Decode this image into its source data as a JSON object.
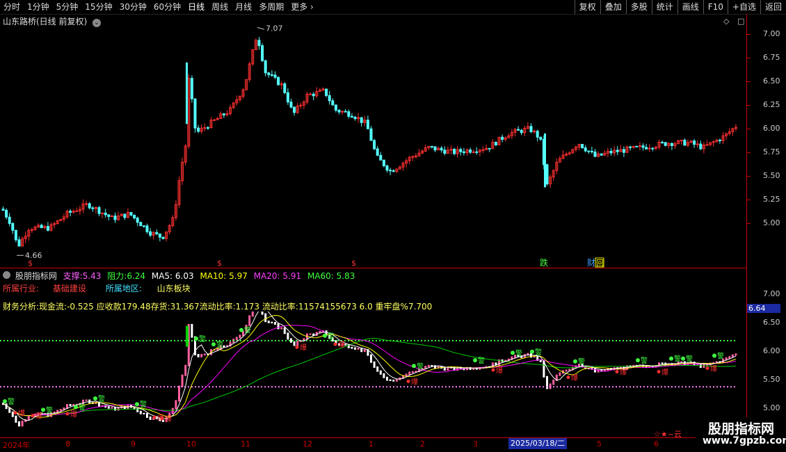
{
  "toolbar": {
    "periods": [
      "分时",
      "1分钟",
      "5分钟",
      "15分钟",
      "30分钟",
      "60分钟",
      "日线",
      "周线",
      "月线",
      "多周期",
      "更多"
    ],
    "active_period": "日线",
    "right_buttons": [
      "复权",
      "叠加",
      "多股",
      "统计",
      "画线",
      "F10",
      "+自选",
      "返回"
    ]
  },
  "main_chart": {
    "title": "山东路桥(日线 前复权)",
    "high_label": "7.07",
    "low_label": "4.66",
    "y_ticks": [
      "7.00",
      "6.75",
      "6.50",
      "6.25",
      "6.00",
      "5.75",
      "5.50",
      "5.25",
      "5.00"
    ],
    "markers": [
      "跌",
      "财",
      "回"
    ],
    "dividend_marker": "$"
  },
  "indicator": {
    "name": "股朋指标网",
    "support_label": "支撑:",
    "support": "5.43",
    "resist_label": "阻力:",
    "resist": "6.24",
    "ma5": "MA5: 6.03",
    "ma10": "MA10: 5.97",
    "ma20": "MA20: 5.91",
    "ma60": "MA60: 5.83",
    "industry_label": "所属行业:",
    "industry": "基础建设",
    "region_label": "所属地区:",
    "region": "山东板块",
    "finance": "财务分析:现金流:-0.525 应收款179.48存货:31.367流动比率:1.173 流动比率:11574155673 6.0 重牢盘%7.700",
    "y_ticks": [
      "7.00",
      "6.50",
      "6.00",
      "5.50",
      "5.00"
    ],
    "current_price": "6.64",
    "warn_label": "警",
    "burst_label": "爆"
  },
  "x_axis": {
    "labels": [
      "2024年",
      "8",
      "9",
      "10",
      "11",
      "12",
      "1",
      "2",
      "3",
      "2025/03/18/二",
      "5",
      "6"
    ]
  },
  "watermark": {
    "brand": "股朋指标网",
    "url": "www.7gpzb.com",
    "badge": "☆★~云"
  },
  "colors": {
    "up": "#ff3030",
    "down": "#54ffff",
    "axis": "#cc0000",
    "ma5": "#ffffff",
    "ma10": "#ffff00",
    "ma20": "#ff00ff",
    "ma60": "#00cc00"
  }
}
